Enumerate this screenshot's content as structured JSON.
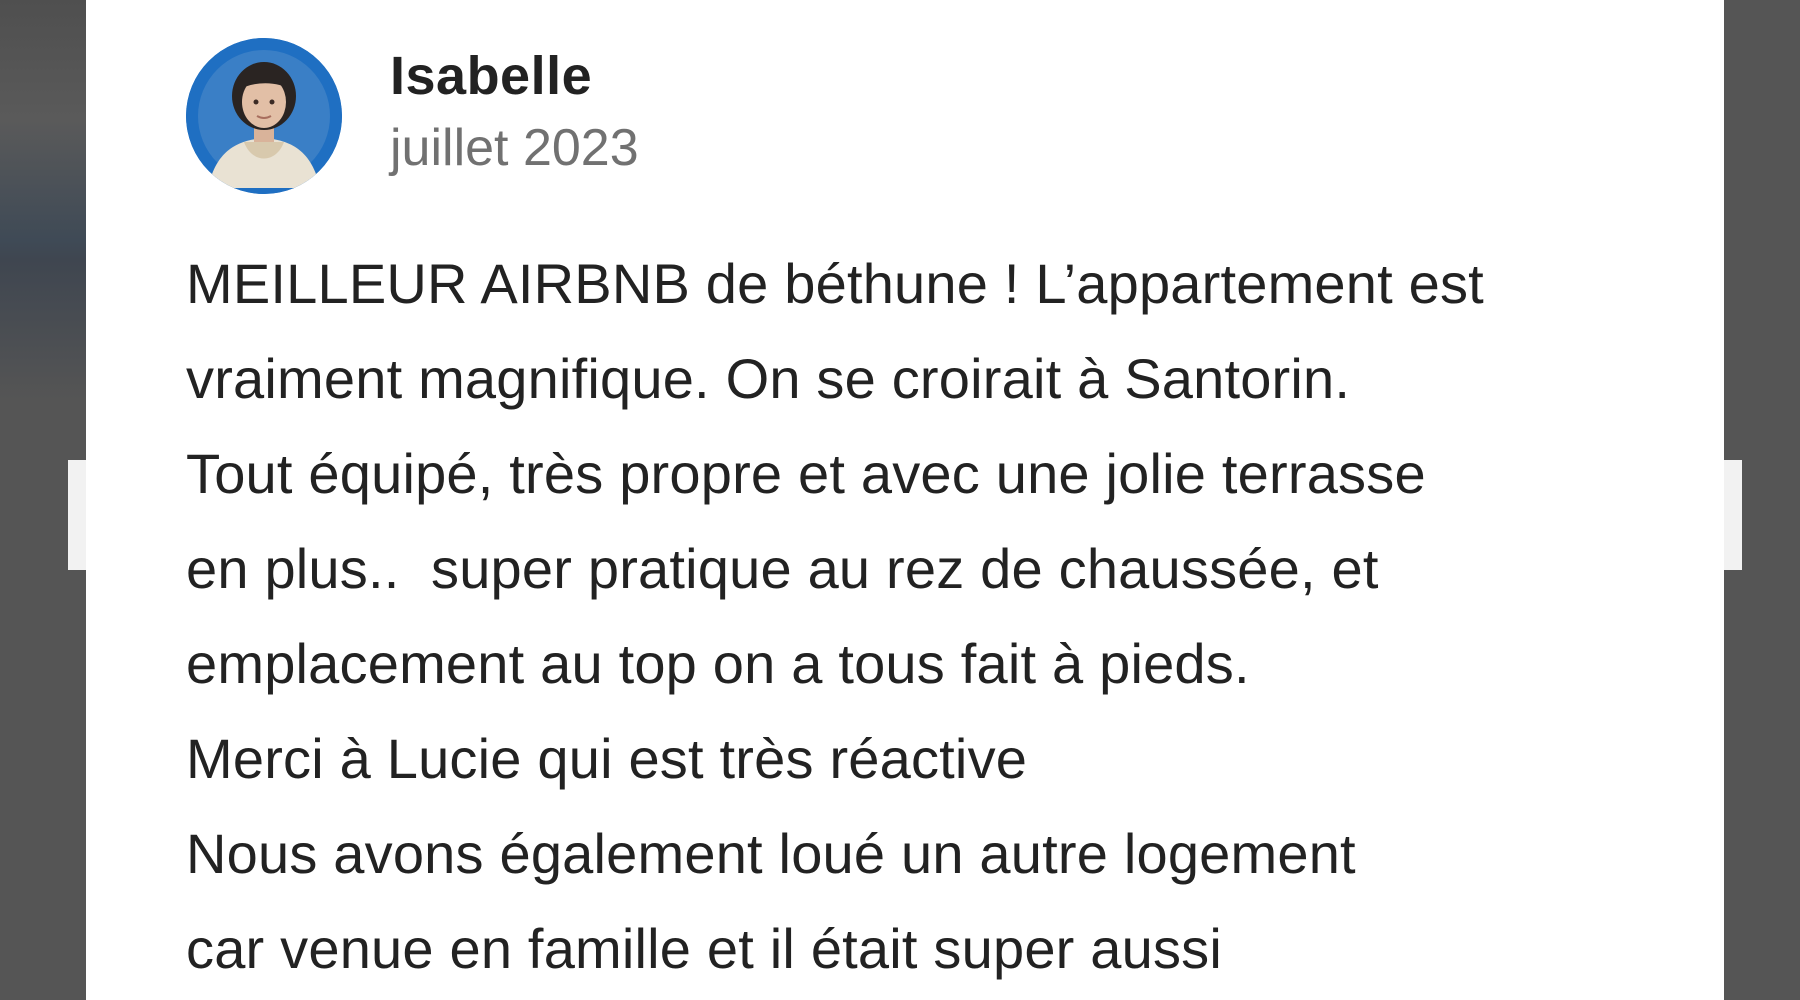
{
  "review": {
    "reviewer_name": "Isabelle",
    "date": "juillet 2023",
    "avatar_icon": "user-photo-avatar",
    "lines": [
      "MEILLEUR AIRBNB de béthune ! L’appartement est",
      "vraiment magnifique. On se croirait à Santorin.",
      "Tout équipé, très propre et avec une jolie terrasse",
      "en plus..  super pratique au rez de chaussée, et",
      "emplacement au top on a tous fait à pieds.",
      "Merci à Lucie qui est très réactive",
      "Nous avons également loué un autre logement",
      "car venue en famille et il était super aussi"
    ]
  },
  "colors": {
    "backdrop": "#555555",
    "card": "#ffffff",
    "text_primary": "#222222",
    "text_secondary": "#717171",
    "avatar_ring": "#1f6fc2"
  }
}
